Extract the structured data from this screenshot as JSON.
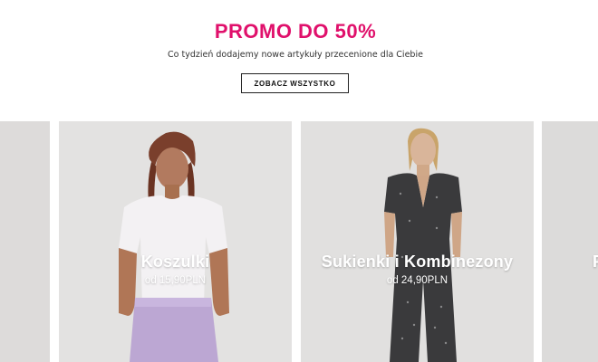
{
  "promo": {
    "title": "PROMO DO 50%",
    "subtitle": "Co tydzień dodajemy nowe artykuły przecenione dla Ciebie",
    "cta_label": "ZOBACZ WSZYSTKO",
    "accent_color": "#e0106b"
  },
  "carousel": {
    "cards": [
      {
        "title": "",
        "price": ""
      },
      {
        "title": "Koszulki",
        "price": "od 15,90PLN"
      },
      {
        "title": "Sukienki i Kombinezony",
        "price": "od 24,90PLN"
      },
      {
        "title": "P",
        "price": ""
      }
    ]
  }
}
